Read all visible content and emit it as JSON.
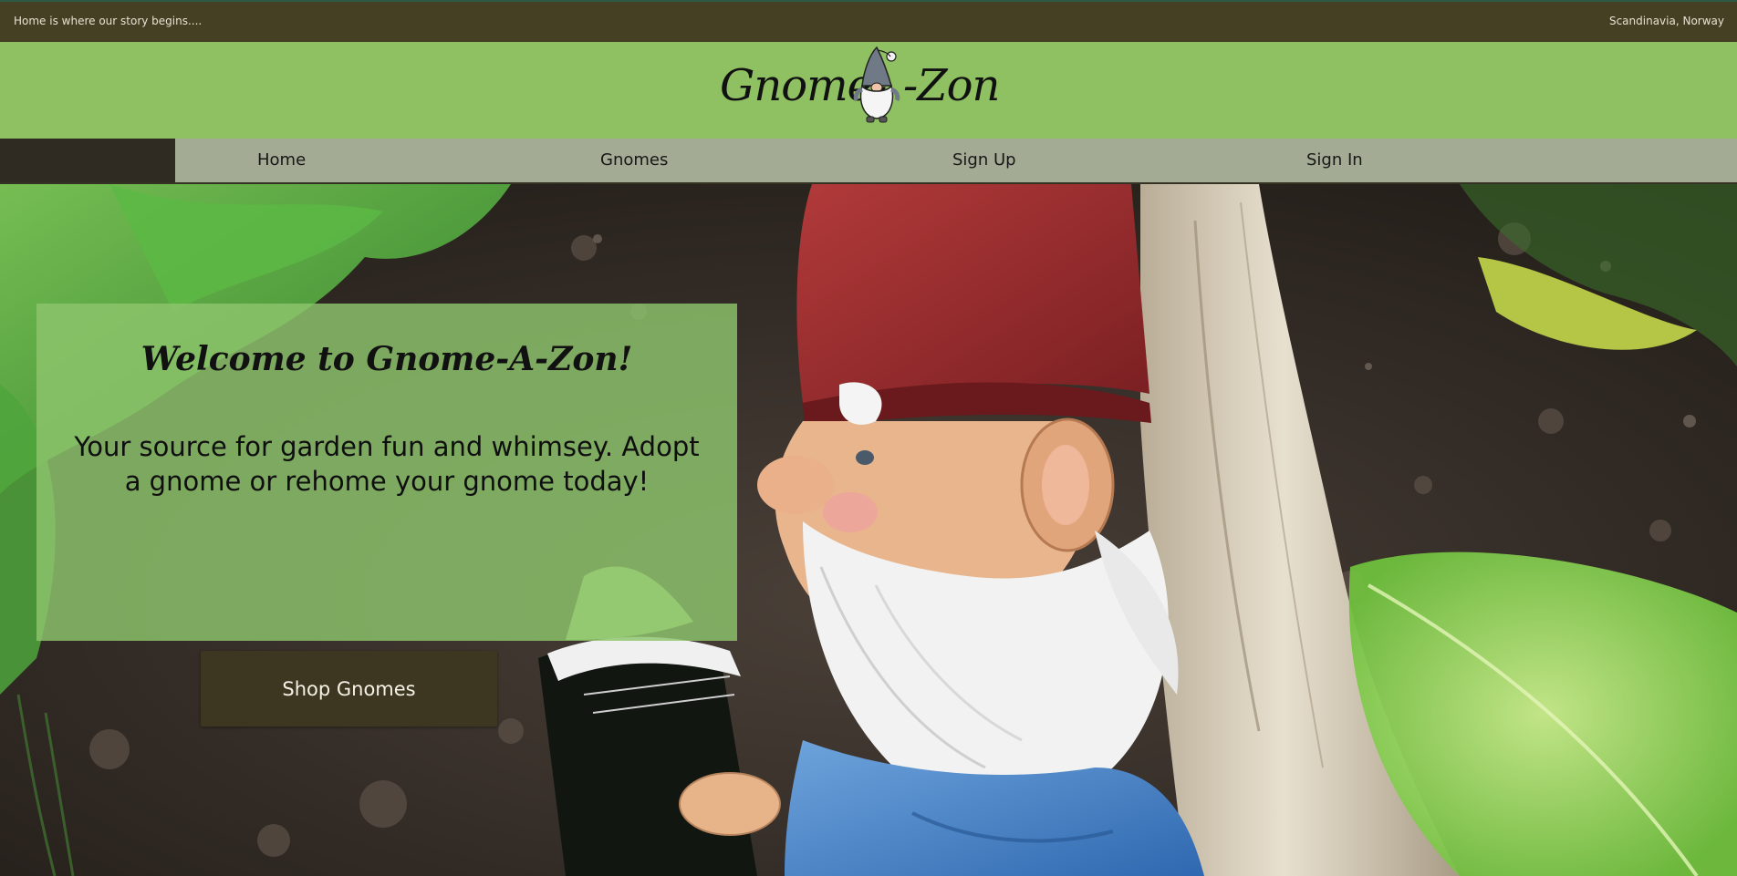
{
  "topbar": {
    "tagline": "Home is where our story begins....",
    "location": "Scandinavia, Norway"
  },
  "header": {
    "logo_left": "Gnome-",
    "logo_right": "-Zon",
    "logo_icon": "gnome-mascot-icon"
  },
  "nav": {
    "items": [
      {
        "label": "Home"
      },
      {
        "label": "Gnomes"
      },
      {
        "label": "Sign Up"
      },
      {
        "label": "Sign In"
      }
    ]
  },
  "hero": {
    "title": "Welcome to Gnome-A-Zon!",
    "subtitle": "Your source for garden fun and whimsey. Adopt a gnome or rehome your gnome today!",
    "cta_label": "Shop Gnomes",
    "background_image": "garden-gnome-reading-book-photo"
  },
  "colors": {
    "topbar_bg": "#453f24",
    "header_bg": "#8fc162",
    "nav_bg": "#a3ab94",
    "panel_bg": "#8ec46c",
    "button_bg": "#3d3621"
  }
}
